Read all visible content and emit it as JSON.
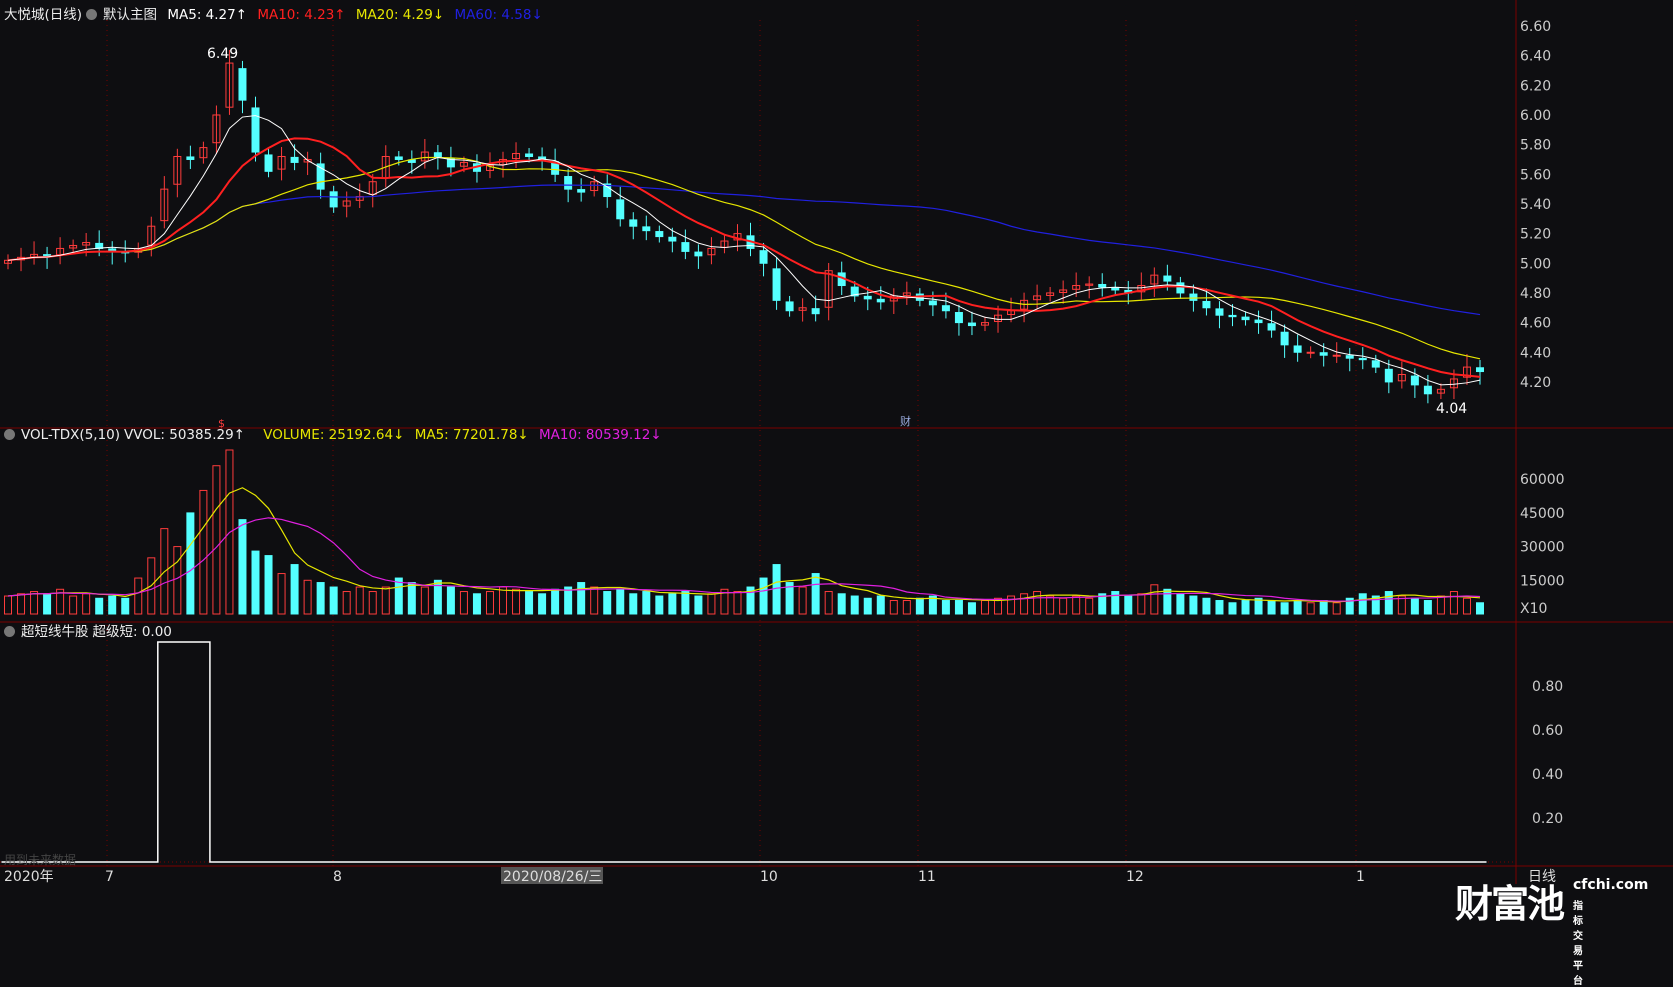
{
  "header": {
    "title": "大悦城(日线)",
    "template": "默认主图",
    "ma5": "MA5: 4.27↑",
    "ma10": "MA10: 4.23↑",
    "ma20": "MA20: 4.29↓",
    "ma60": "MA60: 4.58↓"
  },
  "volume_header": {
    "name": "VOL-TDX(5,10)",
    "vvol": "VVOL: 50385.29↑",
    "volume": "VOLUME: 25192.64↓",
    "ma5": "MA5: 77201.78↓",
    "ma10": "MA10: 80539.12↓"
  },
  "indicator_header": {
    "name": "超短线牛股",
    "value": "超级短: 0.00"
  },
  "future_data_note": "用到未来数据",
  "annotations": {
    "high": "6.49",
    "low": "4.04",
    "marker_cai": "财",
    "marker_dollar": "$"
  },
  "colors": {
    "up": "#ff3c3c",
    "down": "#54ffff",
    "ma5": "#ffffff",
    "ma10": "#ff2020",
    "ma20": "#e6e600",
    "ma60": "#2020e0",
    "vol_ma5": "#e6e600",
    "vol_ma10": "#e020e0",
    "grid": "#7a0000"
  },
  "watermark": {
    "brand": "财富池",
    "domain": "cfchi.com",
    "slogan": "指标交易平台"
  },
  "chart_data": [
    {
      "type": "candlestick",
      "title": "大悦城(日线)",
      "ylim": [
        4.0,
        6.65
      ],
      "yticks": [
        "6.60",
        "6.40",
        "6.20",
        "6.00",
        "5.80",
        "5.60",
        "5.40",
        "5.20",
        "5.00",
        "4.80",
        "4.60",
        "4.40",
        "4.20"
      ],
      "closes": [
        5.02,
        5.04,
        5.06,
        5.05,
        5.1,
        5.12,
        5.14,
        5.1,
        5.08,
        5.07,
        5.1,
        5.25,
        5.5,
        5.72,
        5.7,
        5.78,
        6.0,
        6.35,
        6.1,
        5.75,
        5.62,
        5.72,
        5.68,
        5.7,
        5.5,
        5.38,
        5.42,
        5.45,
        5.55,
        5.72,
        5.7,
        5.68,
        5.75,
        5.72,
        5.65,
        5.68,
        5.62,
        5.66,
        5.7,
        5.74,
        5.72,
        5.7,
        5.6,
        5.5,
        5.48,
        5.55,
        5.45,
        5.3,
        5.25,
        5.22,
        5.18,
        5.15,
        5.08,
        5.05,
        5.1,
        5.15,
        5.2,
        5.1,
        5.0,
        4.75,
        4.68,
        4.7,
        4.66,
        4.95,
        4.85,
        4.78,
        4.76,
        4.74,
        4.78,
        4.8,
        4.75,
        4.72,
        4.68,
        4.6,
        4.58,
        4.6,
        4.65,
        4.68,
        4.75,
        4.78,
        4.8,
        4.82,
        4.85,
        4.86,
        4.84,
        4.82,
        4.8,
        4.85,
        4.92,
        4.88,
        4.8,
        4.75,
        4.7,
        4.65,
        4.64,
        4.62,
        4.6,
        4.55,
        4.45,
        4.4,
        4.4,
        4.38,
        4.38,
        4.36,
        4.35,
        4.3,
        4.2,
        4.25,
        4.18,
        4.12,
        4.15,
        4.22,
        4.3,
        4.27
      ],
      "series": [
        {
          "name": "MA5"
        },
        {
          "name": "MA10"
        },
        {
          "name": "MA20"
        },
        {
          "name": "MA60"
        }
      ]
    },
    {
      "type": "bar",
      "title": "VOL-TDX(5,10)",
      "ylim": [
        0,
        73000
      ],
      "yticks": [
        "60000",
        "45000",
        "30000",
        "15000"
      ],
      "unit_label": "X10",
      "values": [
        8000,
        9000,
        10000,
        9000,
        11000,
        8000,
        9000,
        7000,
        8000,
        7000,
        16000,
        25000,
        38000,
        30000,
        45000,
        55000,
        66000,
        73000,
        42000,
        28000,
        26000,
        18000,
        22000,
        15000,
        14000,
        12000,
        10000,
        12000,
        10000,
        12000,
        16000,
        14000,
        12000,
        15000,
        12000,
        10000,
        9000,
        10000,
        12000,
        11000,
        10000,
        9000,
        11000,
        12000,
        14000,
        12000,
        10000,
        11000,
        9000,
        10000,
        8000,
        9000,
        10000,
        8000,
        9000,
        11000,
        10000,
        12000,
        16000,
        22000,
        14000,
        12000,
        18000,
        10000,
        9000,
        8000,
        7000,
        8000,
        6000,
        6000,
        7000,
        8000,
        6000,
        6000,
        5000,
        6000,
        7000,
        8000,
        9000,
        10000,
        8000,
        7000,
        8000,
        7000,
        9000,
        10000,
        8000,
        9000,
        13000,
        11000,
        9000,
        8000,
        7000,
        6000,
        5000,
        6000,
        7000,
        6000,
        5000,
        6000,
        5000,
        6000,
        5000,
        7000,
        9000,
        8000,
        10000,
        8000,
        7000,
        6000,
        8000,
        10000,
        7000,
        5000
      ],
      "series": [
        {
          "name": "MA5"
        },
        {
          "name": "MA10"
        }
      ]
    },
    {
      "type": "line",
      "title": "超短线牛股",
      "ylim": [
        0,
        1
      ],
      "yticks": [
        "0.80",
        "0.60",
        "0.40",
        "0.20"
      ],
      "values": [
        0,
        0,
        0,
        0,
        0,
        0,
        0,
        0,
        0,
        0,
        0,
        0,
        1,
        1,
        1,
        1,
        0,
        0,
        0,
        0,
        0,
        0,
        0,
        0,
        0,
        0,
        0,
        0,
        0,
        0,
        0,
        0,
        0,
        0,
        0,
        0,
        0,
        0,
        0,
        0,
        0,
        0,
        0,
        0,
        0,
        0,
        0,
        0,
        0,
        0,
        0,
        0,
        0,
        0,
        0,
        0,
        0,
        0,
        0,
        0,
        0,
        0,
        0,
        0,
        0,
        0,
        0,
        0,
        0,
        0,
        0,
        0,
        0,
        0,
        0,
        0,
        0,
        0,
        0,
        0,
        0,
        0,
        0,
        0,
        0,
        0,
        0,
        0,
        0,
        0,
        0,
        0,
        0,
        0,
        0,
        0,
        0,
        0,
        0,
        0,
        0,
        0,
        0,
        0,
        0,
        0,
        0,
        0,
        0,
        0,
        0,
        0,
        0,
        0
      ]
    }
  ],
  "xaxis": {
    "labels": [
      "2020年",
      "7",
      "8",
      "2020/08/26/三",
      "10",
      "11",
      "12",
      "1"
    ],
    "period": "日线"
  }
}
